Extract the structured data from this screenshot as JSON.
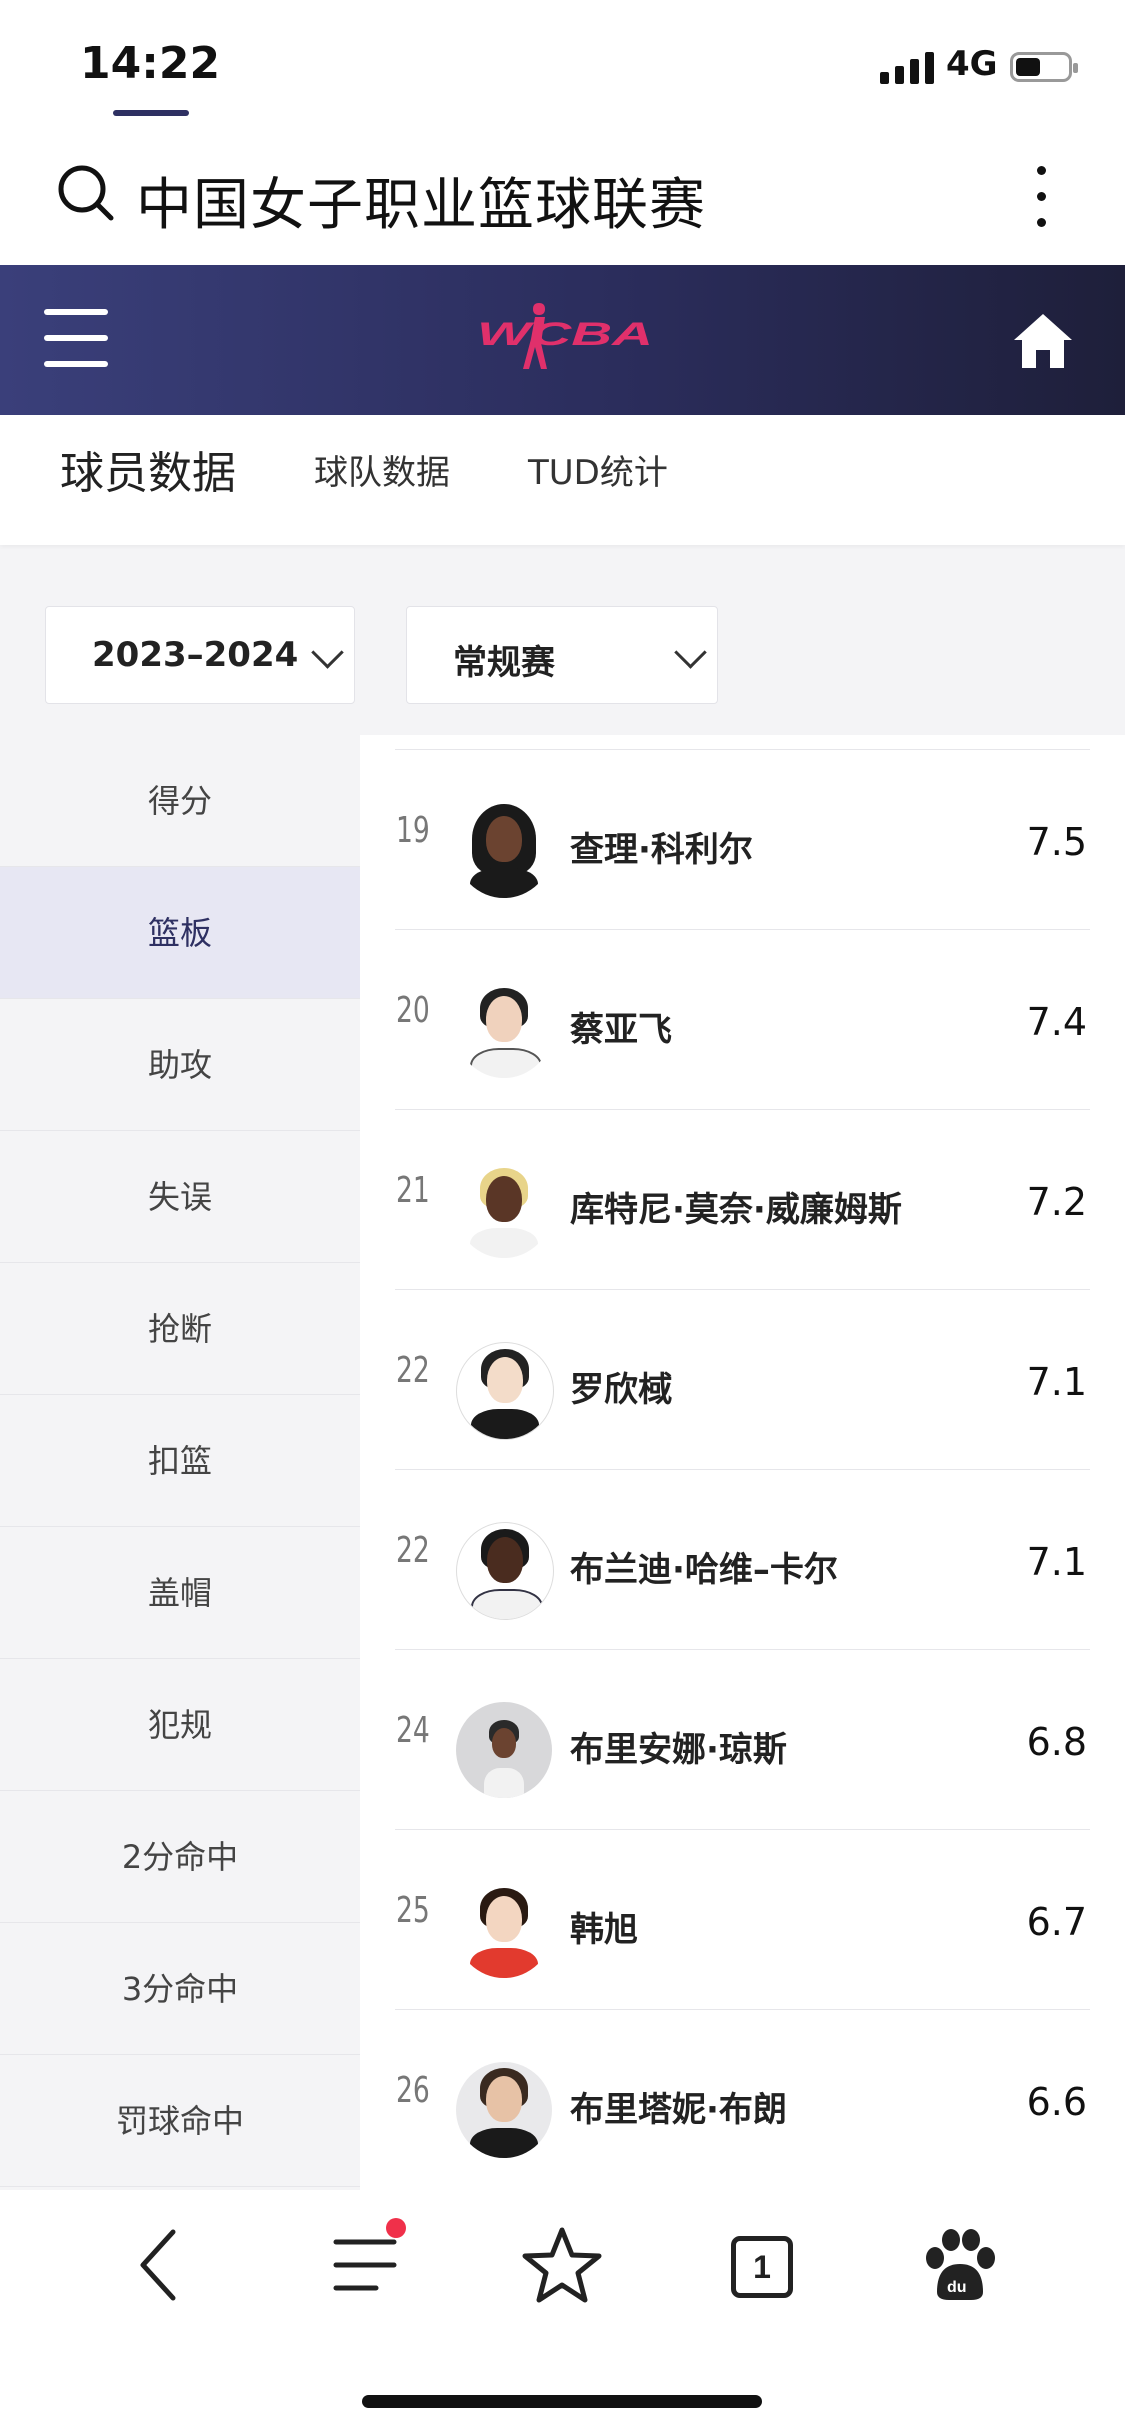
{
  "status": {
    "time": "14:22",
    "network": "4G"
  },
  "search": {
    "query": "中国女子职业篮球联赛"
  },
  "header": {
    "logo_text": "WCBA"
  },
  "tabs": [
    {
      "label": "球员数据",
      "active": true
    },
    {
      "label": "球队数据"
    },
    {
      "label": "TUD统计"
    }
  ],
  "filters": {
    "season": "2023–2024",
    "game_type": "常规赛"
  },
  "categories": [
    {
      "label": "得分"
    },
    {
      "label": "篮板",
      "active": true
    },
    {
      "label": "助攻"
    },
    {
      "label": "失误"
    },
    {
      "label": "抢断"
    },
    {
      "label": "扣篮"
    },
    {
      "label": "盖帽"
    },
    {
      "label": "犯规"
    },
    {
      "label": "2分命中"
    },
    {
      "label": "3分命中"
    },
    {
      "label": "罚球命中"
    }
  ],
  "players": [
    {
      "rank": "19",
      "name": "查理·科利尔",
      "value": "7.5"
    },
    {
      "rank": "20",
      "name": "蔡亚飞",
      "value": "7.4"
    },
    {
      "rank": "21",
      "name": "库特尼·莫奈·威廉姆斯",
      "value": "7.2"
    },
    {
      "rank": "22",
      "name": "罗欣棫",
      "value": "7.1"
    },
    {
      "rank": "22",
      "name": "布兰迪·哈维–卡尔",
      "value": "7.1"
    },
    {
      "rank": "24",
      "name": "布里安娜·琼斯",
      "value": "6.8"
    },
    {
      "rank": "25",
      "name": "韩旭",
      "value": "6.7"
    },
    {
      "rank": "26",
      "name": "布里塔妮·布朗",
      "value": "6.6"
    }
  ],
  "colors": {
    "header_bg": "#2b2d5c",
    "accent": "#2e3062",
    "logo": "#e0306b",
    "badge": "#f0304a"
  },
  "bottom_nav": {
    "tabs_count": "1"
  }
}
